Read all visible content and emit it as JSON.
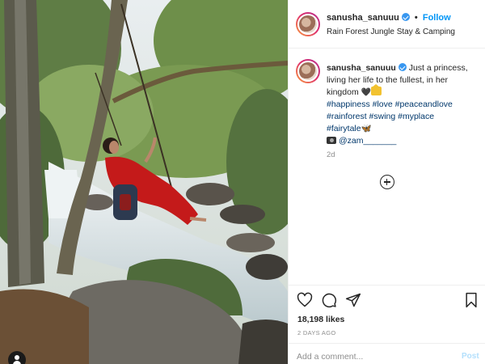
{
  "post": {
    "username": "sanusha_sanuuu",
    "follow_label": "Follow",
    "separator": "•",
    "location": "Rain Forest Jungle Stay & Camping"
  },
  "caption": {
    "username": "sanusha_sanuuu",
    "text": "Just a princess, living her life to the fullest, in her kingdom",
    "heart_emoji": "🖤",
    "hashtags_line1": "#happiness #love #peaceandlove",
    "hashtags_line2": "#rainforest #swing #myplace",
    "hashtags_line3": "#fairytale",
    "butterfly_emoji": "🦋",
    "credit": "@zam_______",
    "time": "2d"
  },
  "stats": {
    "likes": "18,198 likes",
    "date": "2 DAYS AGO"
  },
  "comment_box": {
    "placeholder": "Add a comment...",
    "post_label": "Post"
  },
  "icons": {
    "like": "heart-outline-icon",
    "comment": "speech-bubble-icon",
    "share": "paper-plane-icon",
    "save": "bookmark-icon",
    "load_more": "plus-circle-icon",
    "tagged": "user-tag-icon"
  },
  "colors": {
    "link_blue": "#0095f6",
    "hashtag": "#00376b",
    "muted": "#8e8e8e",
    "post_disabled": "#b2dffc"
  }
}
